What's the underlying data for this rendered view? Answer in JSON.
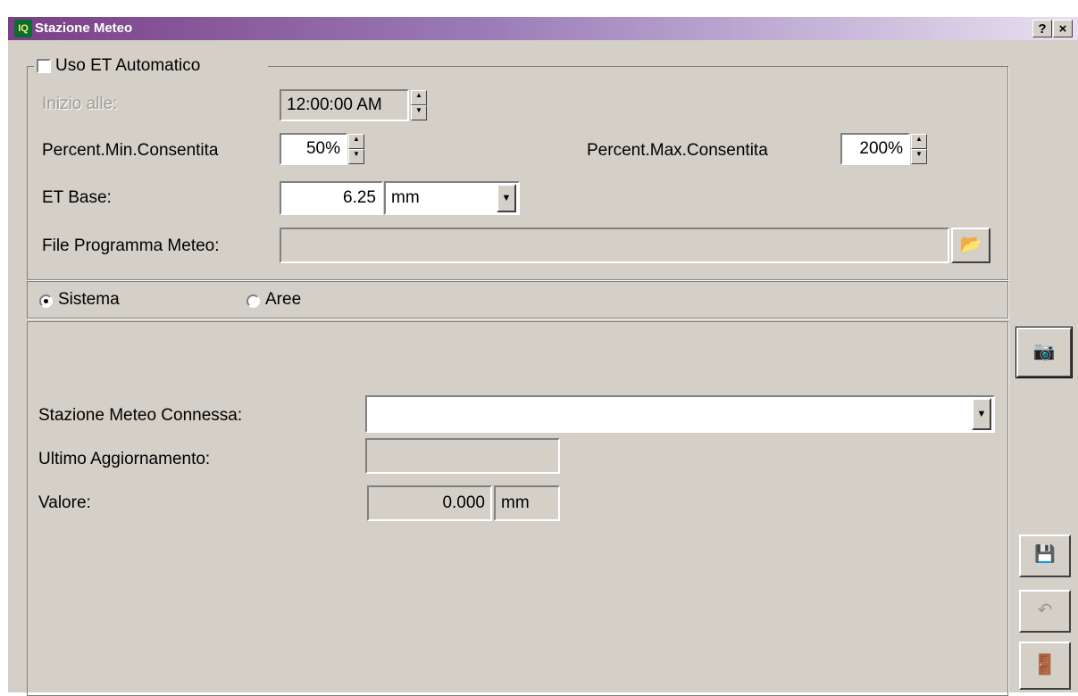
{
  "window": {
    "title": "Stazione Meteo",
    "icon_text": "IQ",
    "help_button": "?",
    "close_button": "×"
  },
  "auto_et": {
    "checkbox_label": "Uso ET Automatico",
    "checked": false,
    "start_label": "Inizio alle:",
    "start_value": "12:00:00 AM",
    "min_percent_label": "Percent.Min.Consentita",
    "min_percent_value": "50%",
    "max_percent_label": "Percent.Max.Consentita",
    "max_percent_value": "200%",
    "et_base_label": "ET Base:",
    "et_base_value": "6.25",
    "et_unit_selected": "mm",
    "file_label": "File Programma Meteo:",
    "file_value": ""
  },
  "mode": {
    "options": [
      {
        "label": "Sistema",
        "selected": true
      },
      {
        "label": "Aree",
        "selected": false
      }
    ]
  },
  "station": {
    "connected_label": "Stazione Meteo Connessa:",
    "connected_value": "",
    "last_update_label": "Ultimo Aggiornamento:",
    "last_update_value": "",
    "value_label": "Valore:",
    "value": "0.000",
    "value_unit": "mm"
  },
  "icons": {
    "browse": "folder-open-icon",
    "camera": "camera-icon",
    "save": "save-icon",
    "undo": "undo-icon",
    "exit": "exit-door-icon"
  },
  "colors": {
    "face": "#d4d0c8",
    "title_start": "#7a3f86",
    "title_end": "#e8e0f0",
    "disabled_text": "#a09c94"
  }
}
